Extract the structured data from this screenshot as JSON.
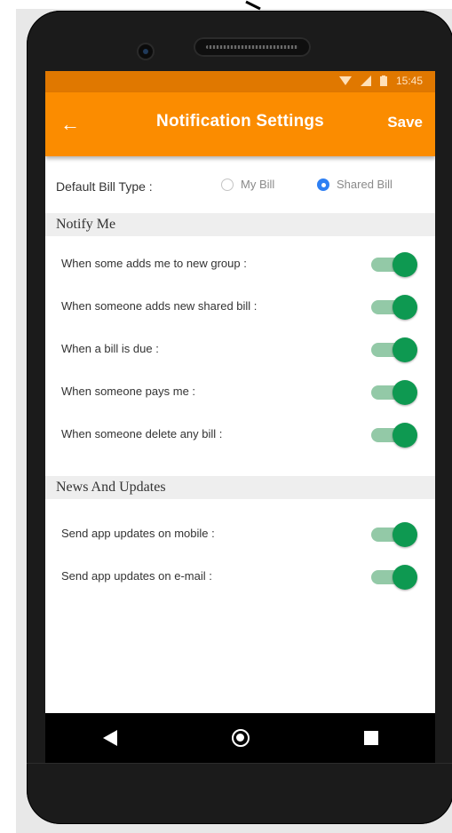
{
  "status": {
    "time": "15:45"
  },
  "appbar": {
    "title": "Notification Settings",
    "save_label": "Save",
    "back_icon": "arrow-left-icon"
  },
  "bill_type": {
    "label": "Default Bill Type :",
    "options": [
      {
        "label": "My Bill",
        "selected": false
      },
      {
        "label": "Shared Bill",
        "selected": true
      }
    ]
  },
  "notify": {
    "header": "Notify Me",
    "items": [
      {
        "label": "When some adds me to new group :",
        "on": true
      },
      {
        "label": "When someone adds new shared bill :",
        "on": true
      },
      {
        "label": "When a bill is due :",
        "on": true
      },
      {
        "label": "When someone pays me :",
        "on": true
      },
      {
        "label": "When someone delete any bill :",
        "on": true
      }
    ]
  },
  "news": {
    "header": "News And Updates",
    "items": [
      {
        "label": "Send app updates on mobile :",
        "on": true
      },
      {
        "label": "Send app updates on e-mail :",
        "on": true
      }
    ]
  },
  "colors": {
    "statusbar": "#e07800",
    "appbar": "#fb8c00",
    "toggle_on": "#0e9951",
    "radio_on": "#2d7ff3"
  }
}
